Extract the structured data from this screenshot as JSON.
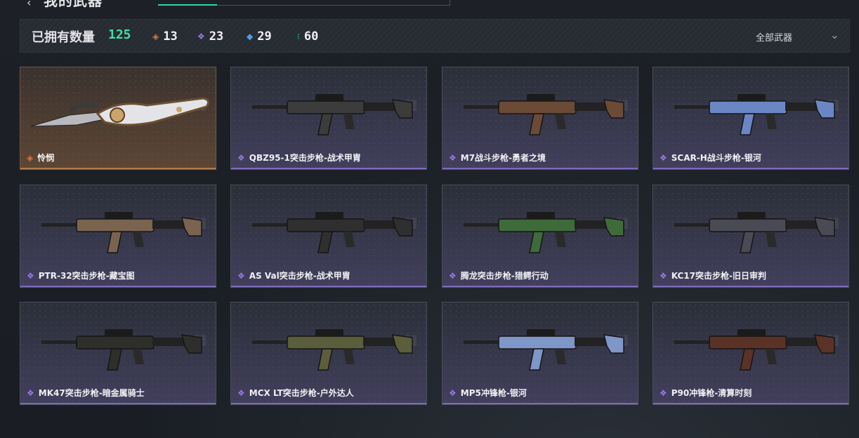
{
  "header": {
    "back_icon": "back-arrow-icon",
    "title": "我的武器"
  },
  "summary": {
    "owned_label": "已拥有数量",
    "owned_count": "125",
    "rarities": [
      {
        "icon": "legendary-gem-icon",
        "count": "13",
        "color": "#d9773f"
      },
      {
        "icon": "epic-gem-icon",
        "count": "23",
        "color": "#9b78e6"
      },
      {
        "icon": "rare-gem-icon",
        "count": "29",
        "color": "#4d9ee8"
      },
      {
        "icon": "common-gem-icon",
        "count": "60",
        "color": "#3ed3a1"
      }
    ],
    "filter": {
      "label": "全部武器",
      "icon": "chevron-down-icon"
    }
  },
  "weapons": [
    {
      "name": "怜悯",
      "rarity": "legendary",
      "color": "#8a7058"
    },
    {
      "name": "QBZ95-1突击步枪-战术甲胄",
      "rarity": "epic",
      "color": "#3c3c3c"
    },
    {
      "name": "M7战斗步枪-勇者之境",
      "rarity": "epic",
      "color": "#6b4a36"
    },
    {
      "name": "SCAR-H战斗步枪-银河",
      "rarity": "epic",
      "color": "#6a86c4"
    },
    {
      "name": "PTR-32突击步枪-藏宝图",
      "rarity": "epic",
      "color": "#7a6450"
    },
    {
      "name": "AS Val突击步枪-战术甲胄",
      "rarity": "epic",
      "color": "#2f2f2f"
    },
    {
      "name": "腾龙突击步枪-猎鳄行动",
      "rarity": "epic",
      "color": "#3f6b3a"
    },
    {
      "name": "KC17突击步枪-旧日审判",
      "rarity": "epic",
      "color": "#4a4a54"
    },
    {
      "name": "MK47突击步枪-暗金属骑士",
      "rarity": "epic",
      "color": "#2e2e2a"
    },
    {
      "name": "MCX LT突击步枪-户外达人",
      "rarity": "epic",
      "color": "#5b5e3a"
    },
    {
      "name": "MP5冲锋枪-银河",
      "rarity": "epic",
      "color": "#7e96c8"
    },
    {
      "name": "P90冲锋枪-清算时刻",
      "rarity": "epic",
      "color": "#5a3226"
    }
  ]
}
